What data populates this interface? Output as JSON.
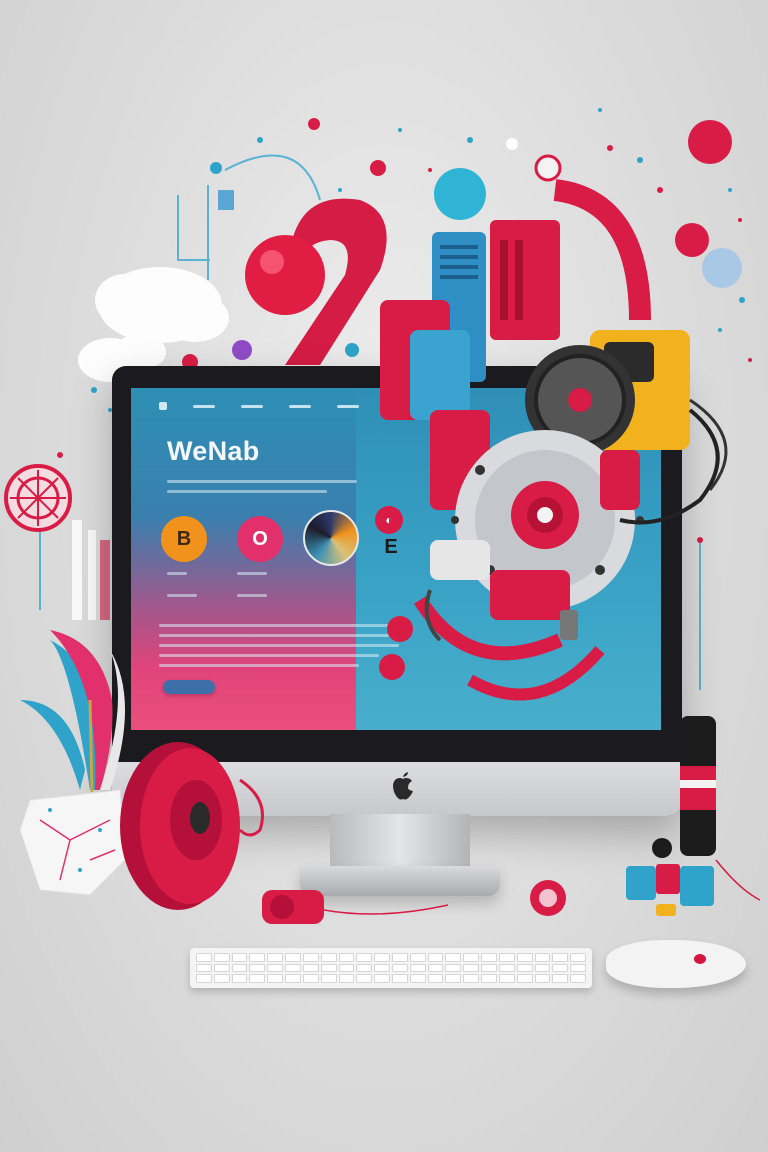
{
  "website": {
    "title": "WeNab",
    "circle_buttons": [
      {
        "label": "B",
        "bg": "#f0921c",
        "fg": "#3d2a10"
      },
      {
        "label": "O",
        "bg": "#e2306d",
        "fg": "#ffffff"
      }
    ],
    "side_glyph": "E"
  },
  "colors": {
    "accent_red": "#d81c46",
    "accent_blue": "#2fa3c9",
    "accent_yellow": "#f2b21e",
    "background": "#dcdcdc"
  },
  "icons": [
    "apple-logo-icon",
    "robot-machine",
    "cloud",
    "plant-in-pot",
    "speaker",
    "mouse",
    "keyboard"
  ]
}
